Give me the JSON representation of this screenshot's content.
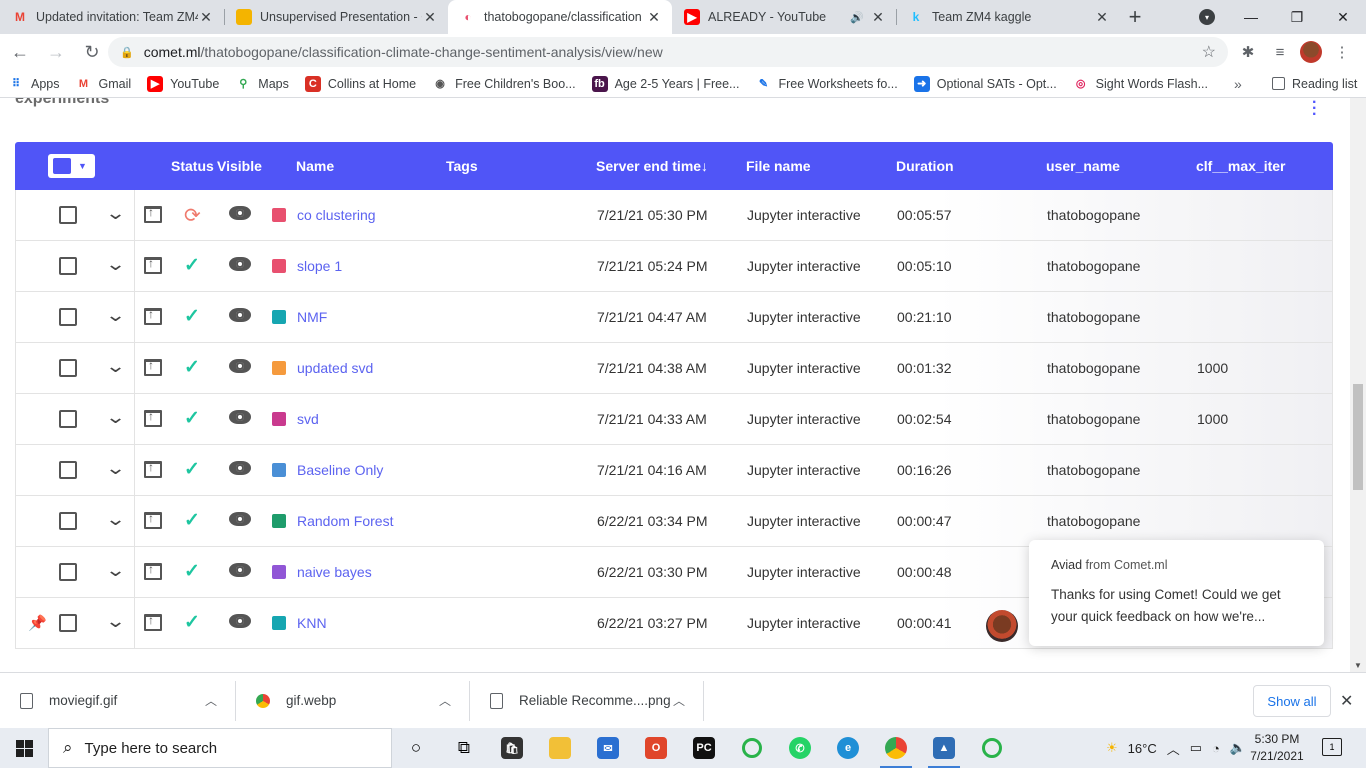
{
  "browser": {
    "tabs": [
      {
        "label": "Updated invitation: Team ZM4",
        "icon": "gmail-icon",
        "active": false
      },
      {
        "label": "Unsupervised Presentation - Go",
        "icon": "slides-icon",
        "active": false
      },
      {
        "label": "thatobogopane/classification",
        "icon": "comet-icon",
        "active": true
      },
      {
        "label": "ALREADY - YouTube",
        "icon": "youtube-icon",
        "active": false,
        "muted": true
      },
      {
        "label": "Team ZM4 kaggle",
        "icon": "kaggle-icon",
        "active": false
      }
    ],
    "tab_close_glyph": "✕",
    "new_tab_glyph": "+",
    "url_host": "comet.ml",
    "url_path": "/thatobogopane/classification-climate-change-sentiment-analysis/view/new",
    "bookmarks": [
      {
        "label": "Apps",
        "icon": "apps-grid-icon"
      },
      {
        "label": "Gmail",
        "icon": "gmail-icon"
      },
      {
        "label": "YouTube",
        "icon": "youtube-icon"
      },
      {
        "label": "Maps",
        "icon": "maps-icon"
      },
      {
        "label": "Collins at Home",
        "icon": "collins-icon"
      },
      {
        "label": "Free Children's Boo...",
        "icon": "books-icon"
      },
      {
        "label": "Age 2-5 Years | Free...",
        "icon": "fb-icon"
      },
      {
        "label": "Free Worksheets fo...",
        "icon": "worksheets-icon"
      },
      {
        "label": "Optional SATs - Opt...",
        "icon": "arrow-icon"
      },
      {
        "label": "Sight Words Flash...",
        "icon": "eye-bookmark-icon"
      }
    ],
    "bookmarks_more": "»",
    "reading_list": "Reading list"
  },
  "page": {
    "section_title": "experiments",
    "columns": {
      "status": "Status",
      "visible": "Visible",
      "name": "Name",
      "tags": "Tags",
      "server_end_time": "Server end time↓",
      "file_name": "File name",
      "duration": "Duration",
      "user_name": "user_name",
      "clf_max_iter": "clf__max_iter"
    },
    "rows": [
      {
        "name": "co clustering",
        "color": "#e8506f",
        "status": "running",
        "time": "7/21/21 05:30 PM",
        "file": "Jupyter interactive",
        "duration": "00:05:57",
        "user": "thatobogopane",
        "max_iter": "",
        "pinned": false
      },
      {
        "name": "slope 1",
        "color": "#e8506f",
        "status": "done",
        "time": "7/21/21 05:24 PM",
        "file": "Jupyter interactive",
        "duration": "00:05:10",
        "user": "thatobogopane",
        "max_iter": "",
        "pinned": false
      },
      {
        "name": "NMF",
        "color": "#16a6b1",
        "status": "done",
        "time": "7/21/21 04:47 AM",
        "file": "Jupyter interactive",
        "duration": "00:21:10",
        "user": "thatobogopane",
        "max_iter": "",
        "pinned": false
      },
      {
        "name": "updated svd",
        "color": "#f59a3d",
        "status": "done",
        "time": "7/21/21 04:38 AM",
        "file": "Jupyter interactive",
        "duration": "00:01:32",
        "user": "thatobogopane",
        "max_iter": "1000",
        "pinned": false
      },
      {
        "name": "svd",
        "color": "#c93a8e",
        "status": "done",
        "time": "7/21/21 04:33 AM",
        "file": "Jupyter interactive",
        "duration": "00:02:54",
        "user": "thatobogopane",
        "max_iter": "1000",
        "pinned": false
      },
      {
        "name": "Baseline Only",
        "color": "#4a8fd6",
        "status": "done",
        "time": "7/21/21 04:16 AM",
        "file": "Jupyter interactive",
        "duration": "00:16:26",
        "user": "thatobogopane",
        "max_iter": "",
        "pinned": false
      },
      {
        "name": "Random Forest",
        "color": "#1e9c6b",
        "status": "done",
        "time": "6/22/21 03:34 PM",
        "file": "Jupyter interactive",
        "duration": "00:00:47",
        "user": "thatobogopane",
        "max_iter": "",
        "pinned": false
      },
      {
        "name": "naive bayes",
        "color": "#9156d6",
        "status": "done",
        "time": "6/22/21 03:30 PM",
        "file": "Jupyter interactive",
        "duration": "00:00:48",
        "user": "",
        "max_iter": "",
        "pinned": false
      },
      {
        "name": "KNN",
        "color": "#16a6b1",
        "status": "done",
        "time": "6/22/21 03:27 PM",
        "file": "Jupyter interactive",
        "duration": "00:00:41",
        "user": "",
        "max_iter": "",
        "pinned": true
      }
    ],
    "toast": {
      "sender": "Aviad",
      "from_suffix": "from Comet.ml",
      "message": "Thanks for using Comet! Could we get your quick feedback on how we're..."
    }
  },
  "downloads": {
    "items": [
      {
        "label": "moviegif.gif",
        "icon": "file-icon"
      },
      {
        "label": "gif.webp",
        "icon": "chrome-icon"
      },
      {
        "label": "Reliable Recomme....png",
        "icon": "file-icon"
      }
    ],
    "show_all": "Show all"
  },
  "taskbar": {
    "search_placeholder": "Type here to search",
    "weather": "16°C",
    "time": "5:30 PM",
    "date": "7/21/2021",
    "notification_count": "1"
  }
}
